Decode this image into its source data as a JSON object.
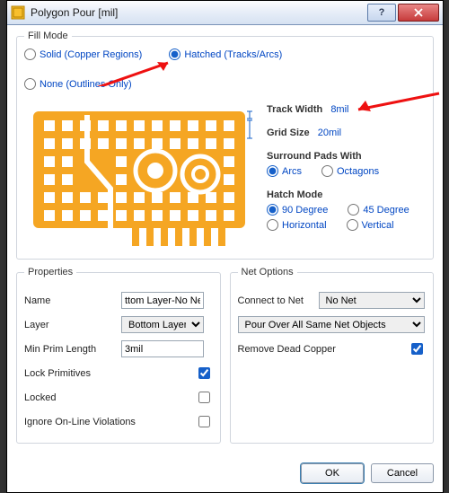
{
  "window": {
    "title": "Polygon Pour [mil]"
  },
  "fill_mode": {
    "legend": "Fill Mode",
    "options": {
      "solid": {
        "label": "Solid (Copper Regions)",
        "selected": false
      },
      "hatched": {
        "label": "Hatched (Tracks/Arcs)",
        "selected": true
      },
      "none": {
        "label": "None (Outlines Only)",
        "selected": false
      }
    }
  },
  "hatch": {
    "track_width": {
      "label": "Track Width",
      "value": "8mil"
    },
    "grid_size": {
      "label": "Grid Size",
      "value": "20mil"
    },
    "surround": {
      "label": "Surround Pads With",
      "arcs": "Arcs",
      "octagons": "Octagons",
      "value": "arcs"
    },
    "hatch_mode": {
      "label": "Hatch Mode",
      "ninety": "90 Degree",
      "fortyfive": "45 Degree",
      "horizontal": "Horizontal",
      "vertical": "Vertical",
      "value": "90"
    }
  },
  "properties": {
    "legend": "Properties",
    "name": {
      "label": "Name",
      "value": "ttom Layer-No Net"
    },
    "layer": {
      "label": "Layer",
      "value": "Bottom Layer"
    },
    "min_prim": {
      "label": "Min Prim Length",
      "value": "3mil"
    },
    "lock_primitives": {
      "label": "Lock Primitives",
      "checked": true
    },
    "locked": {
      "label": "Locked",
      "checked": false
    },
    "ignore_drc": {
      "label": "Ignore On-Line Violations",
      "checked": false
    }
  },
  "net_options": {
    "legend": "Net Options",
    "connect_to_net": {
      "label": "Connect to Net",
      "value": "No Net"
    },
    "pour_rule": "Pour Over All Same Net Objects",
    "remove_dead": {
      "label": "Remove Dead Copper",
      "checked": true
    }
  },
  "buttons": {
    "ok": "OK",
    "cancel": "Cancel"
  }
}
